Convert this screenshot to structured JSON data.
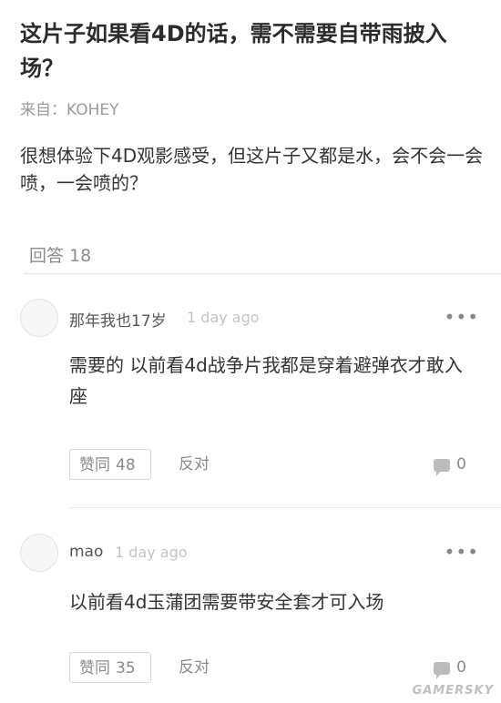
{
  "question": {
    "title": "这片子如果看4D的话，需不需要自带雨披入场？",
    "source": "来自：KOHEY",
    "body": "很想体验下4D观影感受，但这片子又都是水，会不会一会喷，一会喷的？"
  },
  "answers_header": {
    "label": "回答",
    "count": "18"
  },
  "answers": [
    {
      "author": "那年我也17岁",
      "time": "1 day ago",
      "more": "•••",
      "text": "需要的 以前看4d战争片我都是穿着避弹衣才敢入座",
      "agree_label": "赞同",
      "agree_count": "48",
      "oppose_label": "反对",
      "comment_count": "0"
    },
    {
      "author": "mao",
      "time": "1 day ago",
      "more": "•••",
      "text": "以前看4d玉蒲团需要带安全套才可入场",
      "agree_label": "赞同",
      "agree_count": "35",
      "oppose_label": "反对",
      "comment_count": "0"
    }
  ],
  "watermark": "GAMERSKY"
}
